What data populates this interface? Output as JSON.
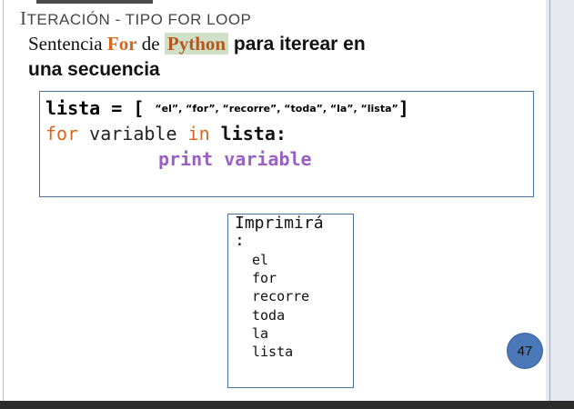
{
  "slide": {
    "title_cap": "I",
    "title_rest": "TERACIÓN",
    "title_sep": " - ",
    "title_small": "TIPO FOR LOOP",
    "subtitle": {
      "prefix": "Sentencia ",
      "kw_for": "For",
      "mid": " de ",
      "kw_python": "Python",
      "rest_line1": "  para iterear en",
      "rest_line2": "una secuencia"
    },
    "code": {
      "line1_start": "lista = [ ",
      "line1_items": "“el”, “for”, “recorre”, “toda”, “la”, “lista”",
      "line1_end": "]",
      "line2_kw1": "for",
      "line2_var": " variable ",
      "line2_kw2": "in",
      "line2_list": " lista:",
      "line3": "print variable"
    },
    "output": {
      "heading_line1": "Imprimirá",
      "heading_line2": ":",
      "items": [
        "el",
        "for",
        "recorre",
        "toda",
        "la",
        "lista"
      ]
    },
    "page_number": "47"
  },
  "colors": {
    "keyword_orange": "#d9661a",
    "print_purple": "#9a5fc4",
    "box_border": "#4a6fa5",
    "page_circle": "#4a78b8"
  }
}
